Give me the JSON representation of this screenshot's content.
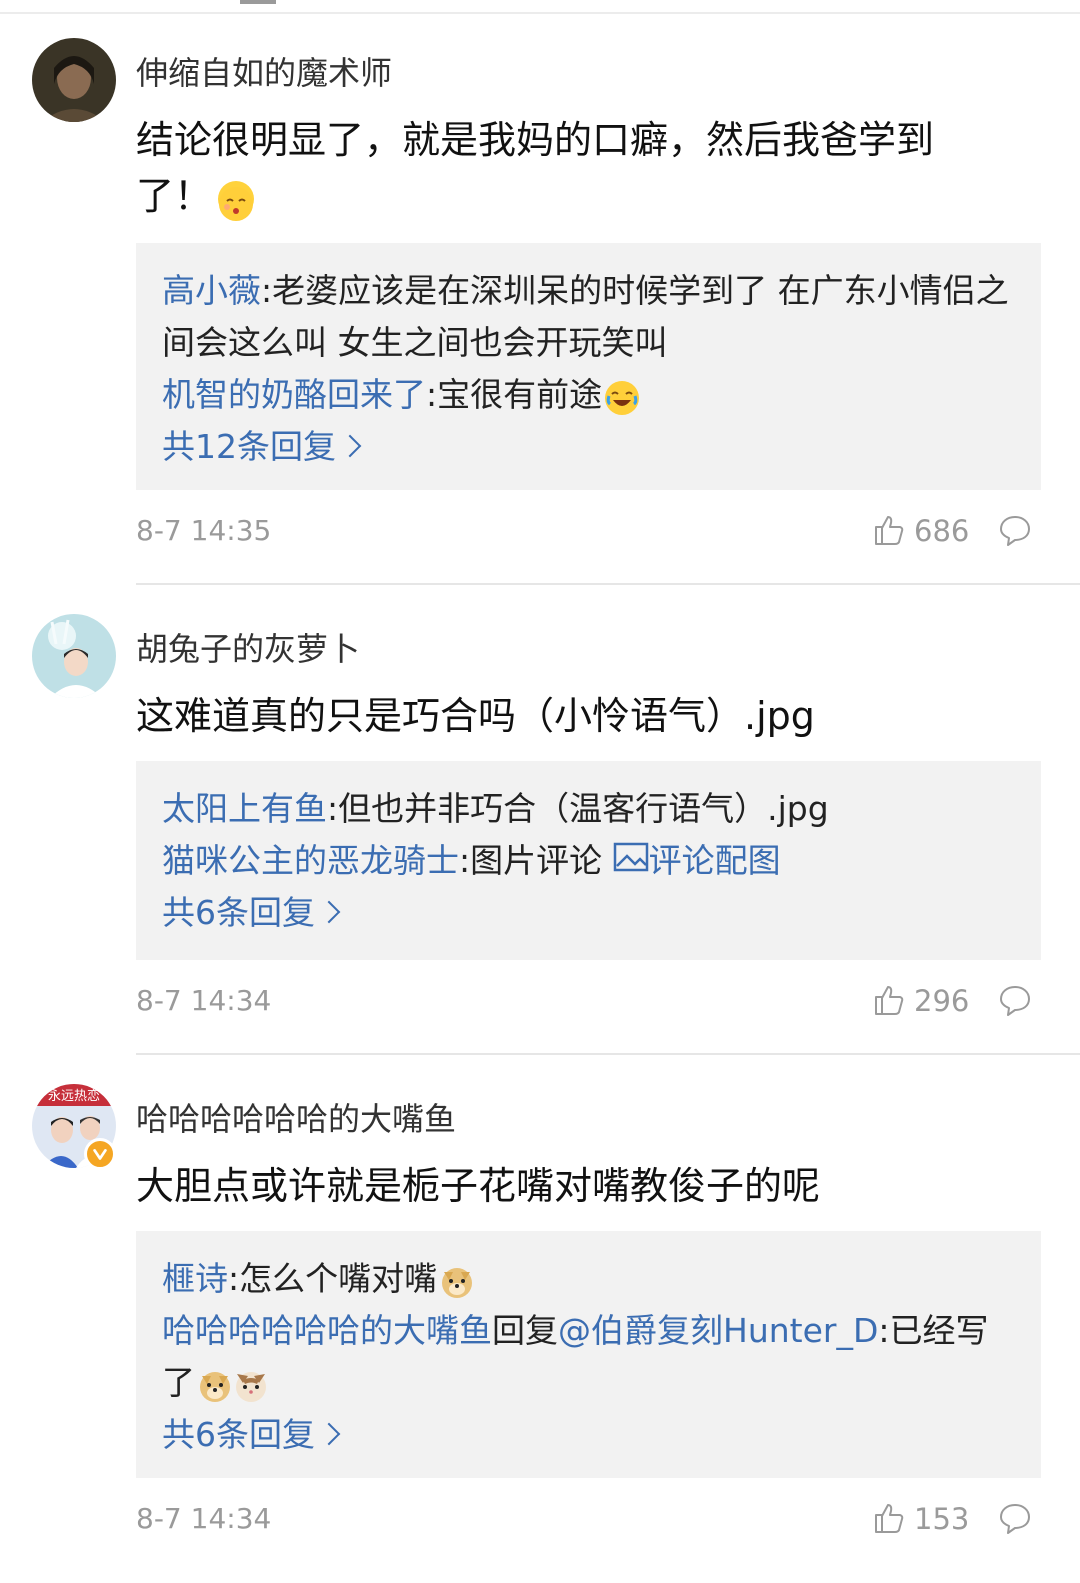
{
  "comments": [
    {
      "username": "伸缩自如的魔术师",
      "text": "结论很明显了，就是我妈的口癖，然后我爸学到了！",
      "emoji": "kiss-emoji",
      "replies": [
        {
          "name": "高小薇",
          "text": ":老婆应该是在深圳呆的时候学到了 在广东小情侣之间会这么叫 女生之间也会开玩笑叫"
        },
        {
          "name": "机智的奶酪回来了",
          "text": ":宝很有前途",
          "emoji": "laugh-cry-emoji"
        }
      ],
      "more_replies": "共12条回复",
      "time": "8-7 14:35",
      "likes": "686"
    },
    {
      "username": "胡兔子的灰萝卜",
      "text": "这难道真的只是巧合吗（小怜语气）.jpg",
      "replies": [
        {
          "name": "太阳上有鱼",
          "text": ":但也并非巧合（温客行语气）.jpg"
        },
        {
          "name": "猫咪公主的恶龙骑士",
          "text": ":图片评论 ",
          "link": "评论配图"
        }
      ],
      "more_replies": "共6条回复",
      "time": "8-7 14:34",
      "likes": "296"
    },
    {
      "username": "哈哈哈哈哈哈的大嘴鱼",
      "avatar_text": "永远热恋",
      "text": "大胆点或许就是栀子花嘴对嘴教俊子的呢",
      "replies": [
        {
          "name": "榧诗",
          "text": ":怎么个嘴对嘴"
        },
        {
          "name": "哈哈哈哈哈哈的大嘴鱼",
          "mid": "回复",
          "mention": "@伯爵复刻Hunter_D",
          "text": ":已经写了"
        }
      ],
      "more_replies": "共6条回复",
      "time": "8-7 14:34",
      "likes": "153"
    }
  ],
  "colors": {
    "link": "#3b6db2",
    "meta": "#9a9a9a",
    "reply_bg": "#f2f2f2",
    "verified": "#f5a623"
  }
}
